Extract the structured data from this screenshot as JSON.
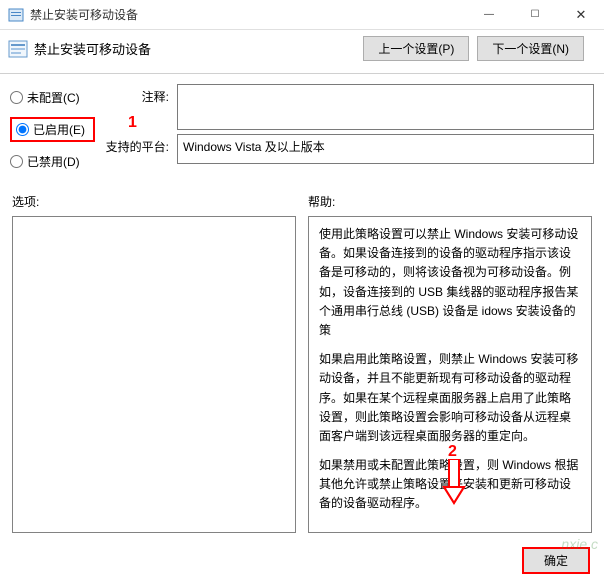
{
  "window": {
    "title": "禁止安装可移动设备"
  },
  "header": {
    "title": "禁止安装可移动设备"
  },
  "nav": {
    "prev": "上一个设置(P)",
    "next": "下一个设置(N)"
  },
  "radios": {
    "not_configured": "未配置(C)",
    "enabled": "已启用(E)",
    "disabled": "已禁用(D)"
  },
  "fields": {
    "comment_label": "注释:",
    "comment_value": "",
    "platform_label": "支持的平台:",
    "platform_value": "Windows Vista 及以上版本"
  },
  "labels": {
    "options": "选项:",
    "help": "帮助:"
  },
  "help": {
    "p1": "使用此策略设置可以禁止 Windows 安装可移动设备。如果设备连接到的设备的驱动程序指示该设备是可移动的，则将该设备视为可移动设备。例如，设备连接到的 USB 集线器的驱动程序报告某个通用串行总线 (USB) 设备是                                                                                                 idows 安装设备的策",
    "p2": "如果启用此策略设置，则禁止 Windows 安装可移动设备，并且不能更新现有可移动设备的驱动程序。如果在某个远程桌面服务器上启用了此策略设置，则此策略设置会影响可移动设备从远程桌面客户端到该远程桌面服务器的重定向。",
    "p3": "如果禁用或未配置此策略设置，则 Windows 根据其他允许或禁止策略设置来安装和更新可移动设备的设备驱动程序。"
  },
  "footer": {
    "ok": "确定"
  },
  "annot": {
    "one": "1",
    "two": "2"
  },
  "watermark": "nxie.c"
}
